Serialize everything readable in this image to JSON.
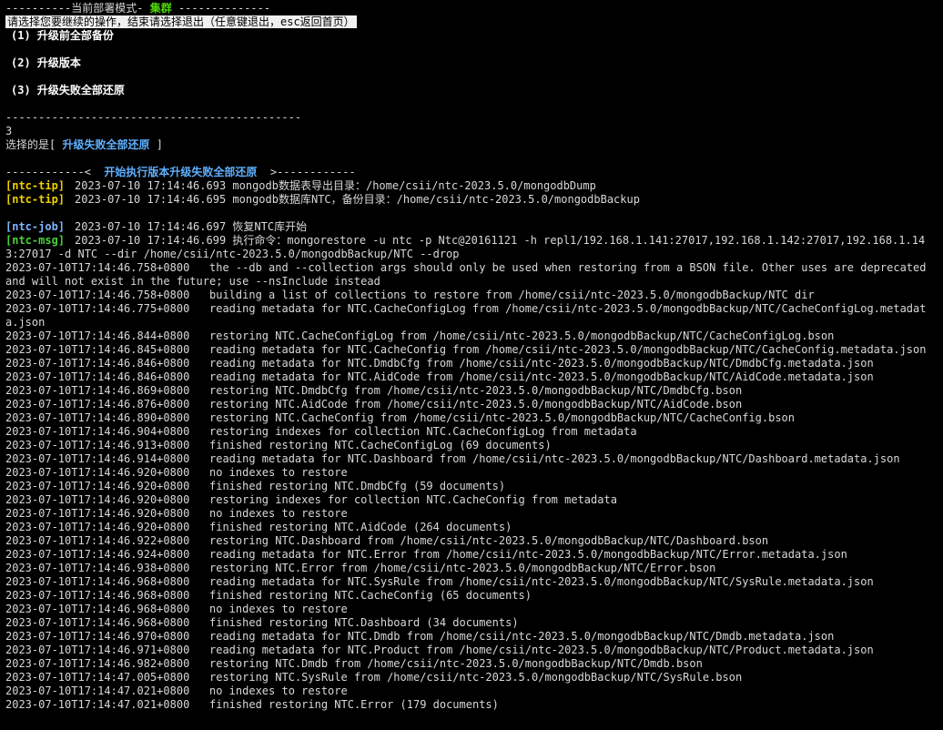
{
  "header": {
    "dashes_left": "----------当前部署模式- ",
    "mode": "集群",
    "dashes_right": " --------------"
  },
  "prompt": "请选择您要继续的操作，结束请选择退出（任意键退出，esc返回首页）",
  "menu": [
    {
      "label": "(1) 升级前全部备份"
    },
    {
      "label": "(2) 升级版本"
    },
    {
      "label": "(3) 升级失败全部还原"
    }
  ],
  "separator": "---------------------------------------------",
  "input_value": "3",
  "selection": {
    "prefix": "选择的是[ ",
    "choice": "升级失败全部还原",
    "suffix": " ]"
  },
  "exec_banner": {
    "left": "------------<  ",
    "text": "开始执行版本升级失败全部还原",
    "right": "  >------------"
  },
  "tips": [
    {
      "tag": "[ntc-tip]",
      "text": "2023-07-10 17:14:46.693 mongodb数据表导出目录：/home/csii/ntc-2023.5.0/mongodbDump"
    },
    {
      "tag": "[ntc-tip]",
      "text": "2023-07-10 17:14:46.695 mongodb数据库NTC，备份目录：/home/csii/ntc-2023.5.0/mongodbBackup"
    }
  ],
  "job": {
    "tag": "[ntc-job]",
    "text": "2023-07-10 17:14:46.697 恢复NTC库开始"
  },
  "msg": {
    "tag": "[ntc-msg]",
    "text": "2023-07-10 17:14:46.699 执行命令：mongorestore -u ntc -p Ntc@20161121 -h repl1/192.168.1.141:27017,192.168.1.142:27017,192.168.1.143:27017 -d NTC --dir /home/csii/ntc-2023.5.0/mongodbBackup/NTC --drop"
  },
  "logs": [
    {
      "time": "2023-07-10T17:14:46.758+0800",
      "msg": "the --db and --collection args should only be used when restoring from a BSON file. Other uses are deprecated and will not exist in the future; use --nsInclude instead"
    },
    {
      "time": "2023-07-10T17:14:46.758+0800",
      "msg": "building a list of collections to restore from /home/csii/ntc-2023.5.0/mongodbBackup/NTC dir"
    },
    {
      "time": "2023-07-10T17:14:46.775+0800",
      "msg": "reading metadata for NTC.CacheConfigLog from /home/csii/ntc-2023.5.0/mongodbBackup/NTC/CacheConfigLog.metadata.json"
    },
    {
      "time": "2023-07-10T17:14:46.844+0800",
      "msg": "restoring NTC.CacheConfigLog from /home/csii/ntc-2023.5.0/mongodbBackup/NTC/CacheConfigLog.bson"
    },
    {
      "time": "2023-07-10T17:14:46.845+0800",
      "msg": "reading metadata for NTC.CacheConfig from /home/csii/ntc-2023.5.0/mongodbBackup/NTC/CacheConfig.metadata.json"
    },
    {
      "time": "2023-07-10T17:14:46.846+0800",
      "msg": "reading metadata for NTC.DmdbCfg from /home/csii/ntc-2023.5.0/mongodbBackup/NTC/DmdbCfg.metadata.json"
    },
    {
      "time": "2023-07-10T17:14:46.846+0800",
      "msg": "reading metadata for NTC.AidCode from /home/csii/ntc-2023.5.0/mongodbBackup/NTC/AidCode.metadata.json"
    },
    {
      "time": "2023-07-10T17:14:46.869+0800",
      "msg": "restoring NTC.DmdbCfg from /home/csii/ntc-2023.5.0/mongodbBackup/NTC/DmdbCfg.bson"
    },
    {
      "time": "2023-07-10T17:14:46.876+0800",
      "msg": "restoring NTC.AidCode from /home/csii/ntc-2023.5.0/mongodbBackup/NTC/AidCode.bson"
    },
    {
      "time": "2023-07-10T17:14:46.890+0800",
      "msg": "restoring NTC.CacheConfig from /home/csii/ntc-2023.5.0/mongodbBackup/NTC/CacheConfig.bson"
    },
    {
      "time": "2023-07-10T17:14:46.904+0800",
      "msg": "restoring indexes for collection NTC.CacheConfigLog from metadata"
    },
    {
      "time": "2023-07-10T17:14:46.913+0800",
      "msg": "finished restoring NTC.CacheConfigLog (69 documents)"
    },
    {
      "time": "2023-07-10T17:14:46.914+0800",
      "msg": "reading metadata for NTC.Dashboard from /home/csii/ntc-2023.5.0/mongodbBackup/NTC/Dashboard.metadata.json"
    },
    {
      "time": "2023-07-10T17:14:46.920+0800",
      "msg": "no indexes to restore"
    },
    {
      "time": "2023-07-10T17:14:46.920+0800",
      "msg": "finished restoring NTC.DmdbCfg (59 documents)"
    },
    {
      "time": "2023-07-10T17:14:46.920+0800",
      "msg": "restoring indexes for collection NTC.CacheConfig from metadata"
    },
    {
      "time": "2023-07-10T17:14:46.920+0800",
      "msg": "no indexes to restore"
    },
    {
      "time": "2023-07-10T17:14:46.920+0800",
      "msg": "finished restoring NTC.AidCode (264 documents)"
    },
    {
      "time": "2023-07-10T17:14:46.922+0800",
      "msg": "restoring NTC.Dashboard from /home/csii/ntc-2023.5.0/mongodbBackup/NTC/Dashboard.bson"
    },
    {
      "time": "2023-07-10T17:14:46.924+0800",
      "msg": "reading metadata for NTC.Error from /home/csii/ntc-2023.5.0/mongodbBackup/NTC/Error.metadata.json"
    },
    {
      "time": "2023-07-10T17:14:46.938+0800",
      "msg": "restoring NTC.Error from /home/csii/ntc-2023.5.0/mongodbBackup/NTC/Error.bson"
    },
    {
      "time": "2023-07-10T17:14:46.968+0800",
      "msg": "reading metadata for NTC.SysRule from /home/csii/ntc-2023.5.0/mongodbBackup/NTC/SysRule.metadata.json"
    },
    {
      "time": "2023-07-10T17:14:46.968+0800",
      "msg": "finished restoring NTC.CacheConfig (65 documents)"
    },
    {
      "time": "2023-07-10T17:14:46.968+0800",
      "msg": "no indexes to restore"
    },
    {
      "time": "2023-07-10T17:14:46.968+0800",
      "msg": "finished restoring NTC.Dashboard (34 documents)"
    },
    {
      "time": "2023-07-10T17:14:46.970+0800",
      "msg": "reading metadata for NTC.Dmdb from /home/csii/ntc-2023.5.0/mongodbBackup/NTC/Dmdb.metadata.json"
    },
    {
      "time": "2023-07-10T17:14:46.971+0800",
      "msg": "reading metadata for NTC.Product from /home/csii/ntc-2023.5.0/mongodbBackup/NTC/Product.metadata.json"
    },
    {
      "time": "2023-07-10T17:14:46.982+0800",
      "msg": "restoring NTC.Dmdb from /home/csii/ntc-2023.5.0/mongodbBackup/NTC/Dmdb.bson"
    },
    {
      "time": "2023-07-10T17:14:47.005+0800",
      "msg": "restoring NTC.SysRule from /home/csii/ntc-2023.5.0/mongodbBackup/NTC/SysRule.bson"
    },
    {
      "time": "2023-07-10T17:14:47.021+0800",
      "msg": "no indexes to restore"
    },
    {
      "time": "2023-07-10T17:14:47.021+0800",
      "msg": "finished restoring NTC.Error (179 documents)"
    }
  ],
  "colors": {
    "background": "#000000",
    "text": "#d8d8d8",
    "mode_green": "#4fd60a",
    "selection_blue": "#5fb0ff",
    "tip_yellow": "#f0d000"
  }
}
